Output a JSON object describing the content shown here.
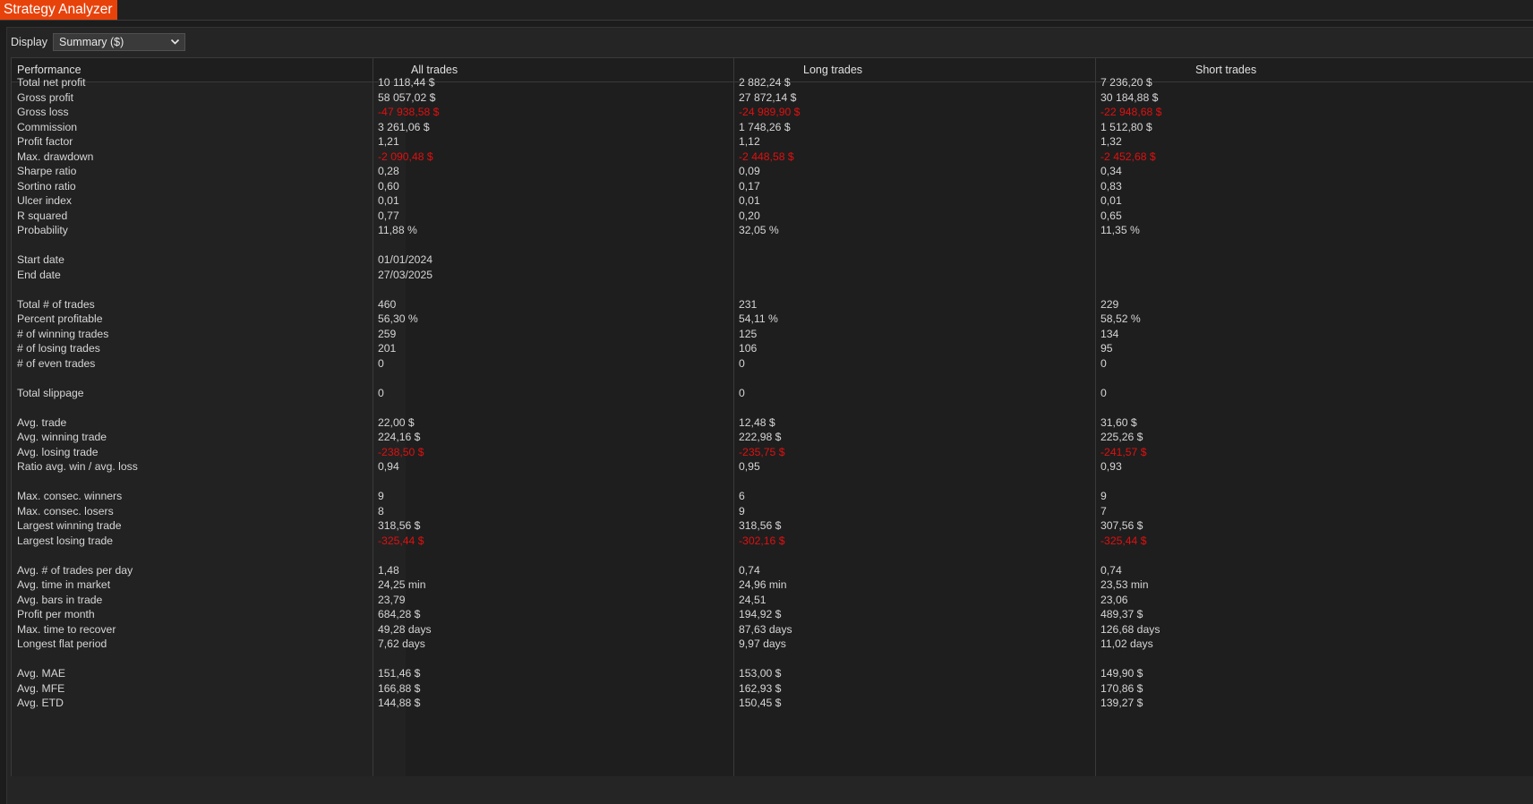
{
  "window": {
    "title": "Strategy Analyzer"
  },
  "display": {
    "label": "Display",
    "selected": "Summary ($)"
  },
  "colors": {
    "accent": "#e8420b",
    "negative": "#e01010",
    "background": "#1c1c1c"
  },
  "table": {
    "headers": [
      "Performance",
      "All trades",
      "Long trades",
      "Short trades"
    ],
    "rows": [
      {
        "label": "Total net profit",
        "values": [
          "10 118,44 $",
          "2 882,24 $",
          "7 236,20 $"
        ]
      },
      {
        "label": "Gross profit",
        "values": [
          "58 057,02 $",
          "27 872,14 $",
          "30 184,88 $"
        ]
      },
      {
        "label": "Gross loss",
        "values": [
          "-47 938,58 $",
          "-24 989,90 $",
          "-22 948,68 $"
        ],
        "negative": true
      },
      {
        "label": "Commission",
        "values": [
          "3 261,06 $",
          "1 748,26 $",
          "1 512,80 $"
        ]
      },
      {
        "label": "Profit factor",
        "values": [
          "1,21",
          "1,12",
          "1,32"
        ]
      },
      {
        "label": "Max. drawdown",
        "values": [
          "-2 090,48 $",
          "-2 448,58 $",
          "-2 452,68 $"
        ],
        "negative": true
      },
      {
        "label": "Sharpe ratio",
        "values": [
          "0,28",
          "0,09",
          "0,34"
        ]
      },
      {
        "label": "Sortino ratio",
        "values": [
          "0,60",
          "0,17",
          "0,83"
        ]
      },
      {
        "label": "Ulcer index",
        "values": [
          "0,01",
          "0,01",
          "0,01"
        ]
      },
      {
        "label": "R squared",
        "values": [
          "0,77",
          "0,20",
          "0,65"
        ]
      },
      {
        "label": "Probability",
        "values": [
          "11,88 %",
          "32,05 %",
          "11,35 %"
        ]
      },
      {
        "label": "",
        "values": [
          "",
          "",
          ""
        ]
      },
      {
        "label": "Start date",
        "values": [
          "01/01/2024",
          "",
          ""
        ]
      },
      {
        "label": "End date",
        "values": [
          "27/03/2025",
          "",
          ""
        ]
      },
      {
        "label": "",
        "values": [
          "",
          "",
          ""
        ]
      },
      {
        "label": "Total # of trades",
        "values": [
          "460",
          "231",
          "229"
        ]
      },
      {
        "label": "Percent profitable",
        "values": [
          "56,30 %",
          "54,11 %",
          "58,52 %"
        ]
      },
      {
        "label": "# of winning trades",
        "values": [
          "259",
          "125",
          "134"
        ]
      },
      {
        "label": "# of losing trades",
        "values": [
          "201",
          "106",
          "95"
        ]
      },
      {
        "label": "# of even trades",
        "values": [
          "0",
          "0",
          "0"
        ]
      },
      {
        "label": "",
        "values": [
          "",
          "",
          ""
        ]
      },
      {
        "label": "Total slippage",
        "values": [
          "0",
          "0",
          "0"
        ]
      },
      {
        "label": "",
        "values": [
          "",
          "",
          ""
        ]
      },
      {
        "label": "Avg. trade",
        "values": [
          "22,00 $",
          "12,48 $",
          "31,60 $"
        ]
      },
      {
        "label": "Avg. winning trade",
        "values": [
          "224,16 $",
          "222,98 $",
          "225,26 $"
        ]
      },
      {
        "label": "Avg. losing trade",
        "values": [
          "-238,50 $",
          "-235,75 $",
          "-241,57 $"
        ],
        "negative": true
      },
      {
        "label": "Ratio avg. win / avg. loss",
        "values": [
          "0,94",
          "0,95",
          "0,93"
        ]
      },
      {
        "label": "",
        "values": [
          "",
          "",
          ""
        ]
      },
      {
        "label": "Max. consec. winners",
        "values": [
          "9",
          "6",
          "9"
        ]
      },
      {
        "label": "Max. consec. losers",
        "values": [
          "8",
          "9",
          "7"
        ]
      },
      {
        "label": "Largest winning trade",
        "values": [
          "318,56 $",
          "318,56 $",
          "307,56 $"
        ]
      },
      {
        "label": "Largest losing trade",
        "values": [
          "-325,44 $",
          "-302,16 $",
          "-325,44 $"
        ],
        "negative": true
      },
      {
        "label": "",
        "values": [
          "",
          "",
          ""
        ]
      },
      {
        "label": "Avg. # of trades per day",
        "values": [
          "1,48",
          "0,74",
          "0,74"
        ]
      },
      {
        "label": "Avg. time in market",
        "values": [
          "24,25 min",
          "24,96 min",
          "23,53 min"
        ]
      },
      {
        "label": "Avg. bars in trade",
        "values": [
          "23,79",
          "24,51",
          "23,06"
        ]
      },
      {
        "label": "Profit per month",
        "values": [
          "684,28 $",
          "194,92 $",
          "489,37 $"
        ]
      },
      {
        "label": "Max. time to recover",
        "values": [
          "49,28 days",
          "87,63 days",
          "126,68 days"
        ]
      },
      {
        "label": "Longest flat period",
        "values": [
          "7,62 days",
          "9,97 days",
          "11,02 days"
        ]
      },
      {
        "label": "",
        "values": [
          "",
          "",
          ""
        ]
      },
      {
        "label": "Avg. MAE",
        "values": [
          "151,46 $",
          "153,00 $",
          "149,90 $"
        ]
      },
      {
        "label": "Avg. MFE",
        "values": [
          "166,88 $",
          "162,93 $",
          "170,86 $"
        ]
      },
      {
        "label": "Avg. ETD",
        "values": [
          "144,88 $",
          "150,45 $",
          "139,27 $"
        ]
      }
    ]
  }
}
